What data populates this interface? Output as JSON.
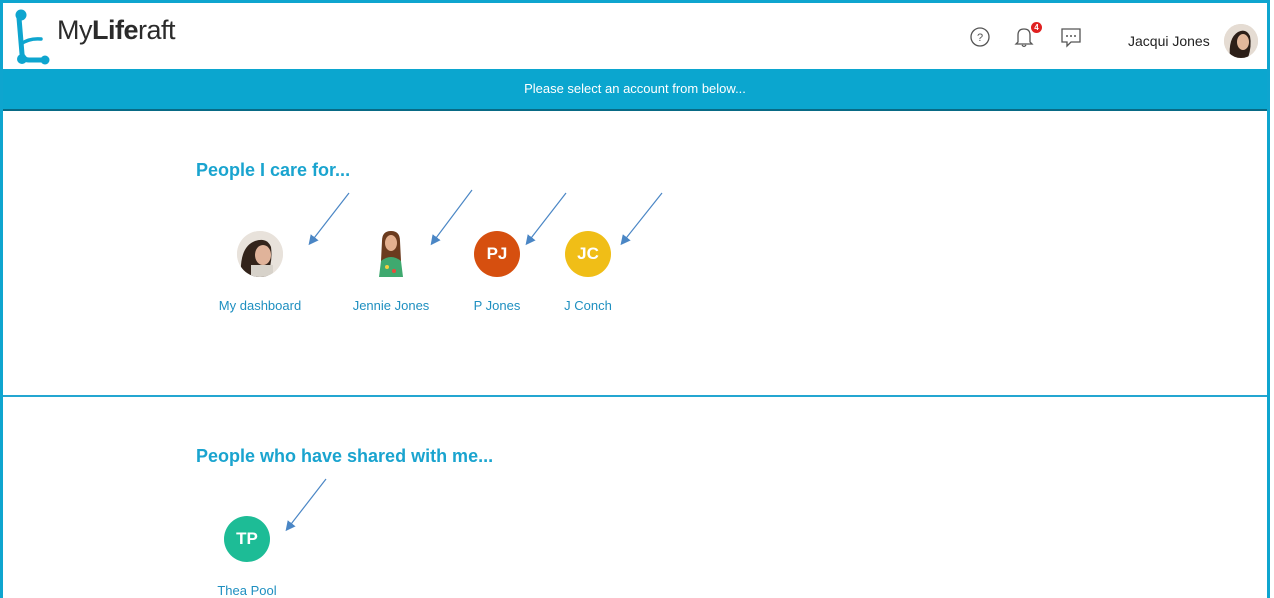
{
  "app": {
    "logo_my": "My",
    "logo_life": "Life",
    "logo_raft": "raft"
  },
  "header": {
    "user_name": "Jacqui Jones",
    "notification_count": "4",
    "icons": [
      "help-icon",
      "bell-icon",
      "chat-icon"
    ]
  },
  "banner": {
    "text": "Please select an account from below..."
  },
  "care_section": {
    "title": "People I care for...",
    "people": [
      {
        "name": "My dashboard",
        "initials": "",
        "kind": "photo"
      },
      {
        "name": "Jennie Jones",
        "initials": "",
        "kind": "photo"
      },
      {
        "name": "P Jones",
        "initials": "PJ",
        "color": "#d64f0f"
      },
      {
        "name": "J Conch",
        "initials": "JC",
        "color": "#f0be17"
      }
    ]
  },
  "shared_section": {
    "title": "People who have shared with me...",
    "people": [
      {
        "name": "Thea Pool",
        "initials": "TP",
        "color": "#1dbc96"
      }
    ]
  },
  "colors": {
    "brand": "#0ea5cf",
    "accent_text": "#1aa4cf"
  }
}
